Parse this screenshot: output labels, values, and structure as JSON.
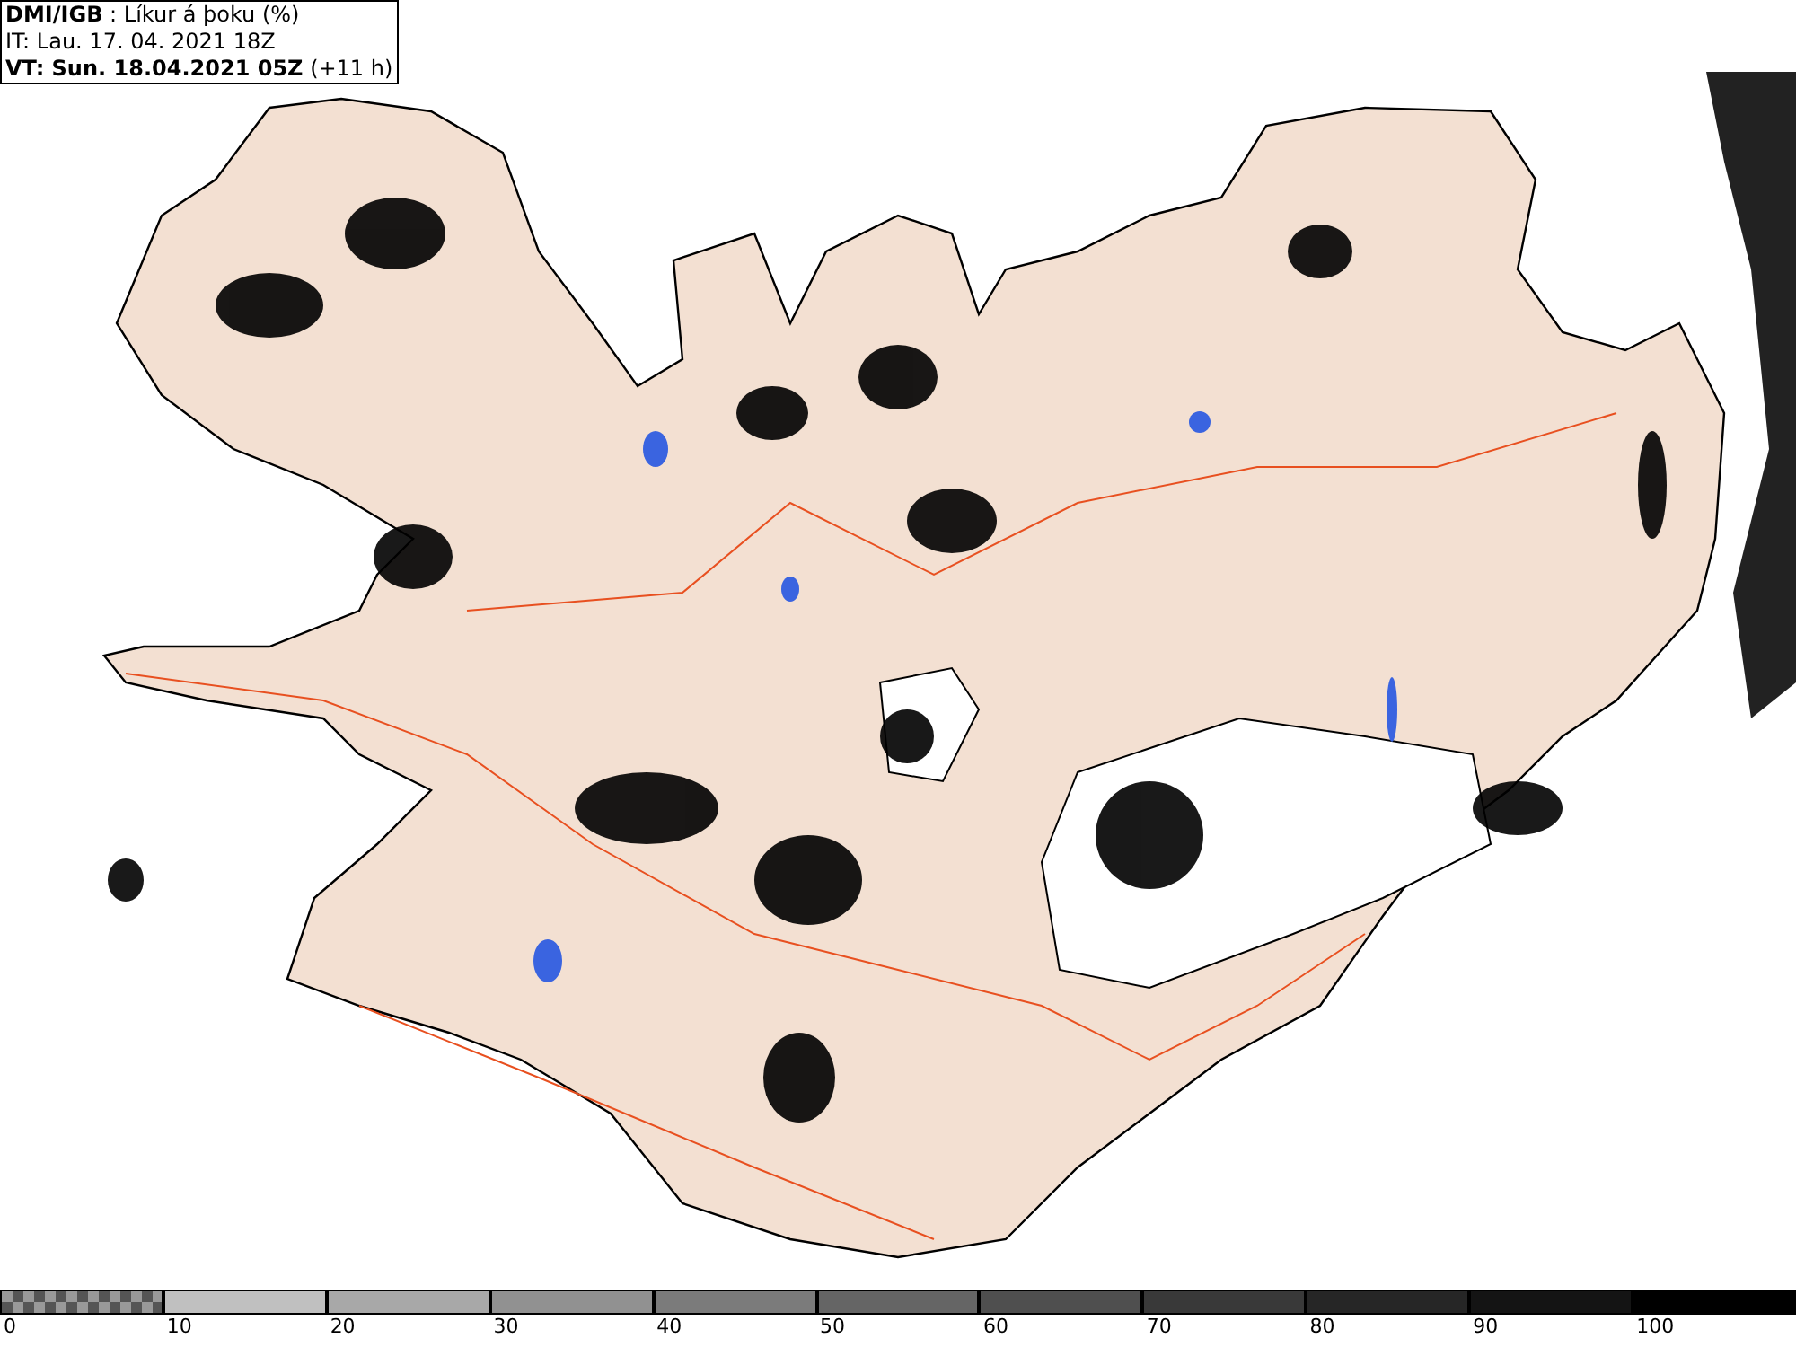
{
  "header": {
    "lines": [
      "**DMI/IGB** : Líkur á þoku (%)",
      "IT: Lau. 17. 04. 2021 18Z",
      "**VT: Sun. 18.04.2021 05Z** (+11 h)"
    ]
  },
  "legend": [
    {
      "kind": "transparent",
      "label": "0"
    },
    {
      "kind": "solid",
      "color": "#c0c0c0",
      "label": "10"
    },
    {
      "kind": "solid",
      "color": "#a8a8a8",
      "label": "20"
    },
    {
      "kind": "solid",
      "color": "#919191",
      "label": "30"
    },
    {
      "kind": "solid",
      "color": "#7b7b7b",
      "label": "40"
    },
    {
      "kind": "solid",
      "color": "#656565",
      "label": "50"
    },
    {
      "kind": "solid",
      "color": "#4f4f4f",
      "label": "60"
    },
    {
      "kind": "solid",
      "color": "#393939",
      "label": "70"
    },
    {
      "kind": "solid",
      "color": "#262626",
      "label": "80"
    },
    {
      "kind": "solid",
      "color": "#141414",
      "label": "90"
    },
    {
      "kind": "solid",
      "color": "#000000",
      "label": "100"
    }
  ]
}
